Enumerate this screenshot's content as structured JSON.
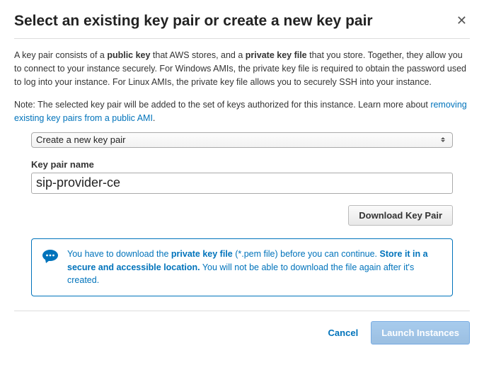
{
  "header": {
    "title": "Select an existing key pair or create a new key pair"
  },
  "description": {
    "pre": "A key pair consists of a ",
    "b1": "public key",
    "mid1": " that AWS stores, and a ",
    "b2": "private key file",
    "post": " that you store. Together, they allow you to connect to your instance securely. For Windows AMIs, the private key file is required to obtain the password used to log into your instance. For Linux AMIs, the private key file allows you to securely SSH into your instance."
  },
  "note": {
    "text": "Note: The selected key pair will be added to the set of keys authorized for this instance. Learn more about ",
    "link": "removing existing key pairs from a public AMI",
    "tail": "."
  },
  "form": {
    "select_value": "Create a new key pair",
    "keypair_label": "Key pair name",
    "keypair_value": "sip-provider-ce",
    "download_label": "Download Key Pair"
  },
  "info": {
    "p1a": "You have to download the ",
    "p1b": "private key file",
    "p1c": " (*.pem file) before you can continue. ",
    "p2b": "Store it in a secure and accessible location.",
    "p2c": " You will not be able to download the file again after it's created."
  },
  "footer": {
    "cancel": "Cancel",
    "launch": "Launch Instances"
  }
}
